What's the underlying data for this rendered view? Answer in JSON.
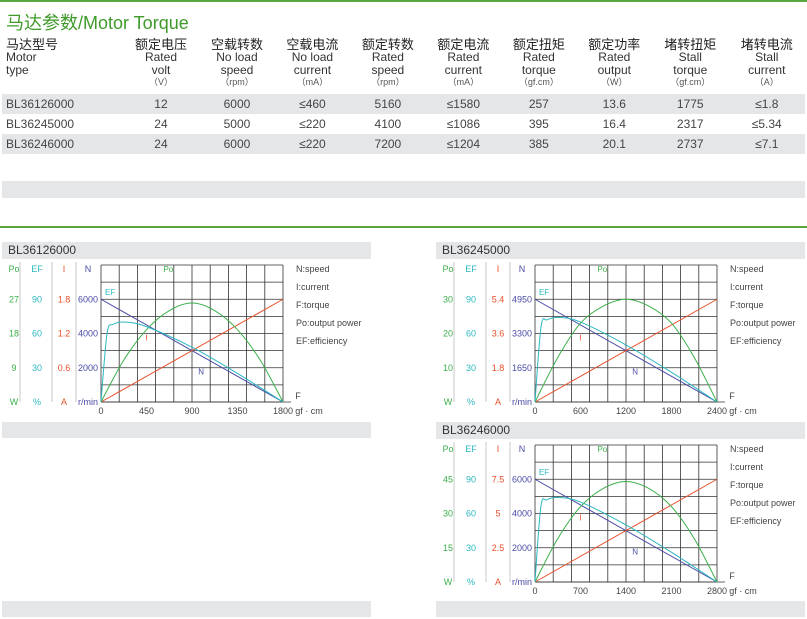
{
  "page_title": "马达参数/Motor Torque",
  "colors": {
    "accent": "#5aa53c",
    "po": "#3bb04a",
    "ef": "#2ab8c0",
    "i": "#e8502a",
    "n": "#4a4aa6",
    "shade": "#e4e6e8"
  },
  "spec_table": {
    "headers": [
      {
        "cn": "马达型号",
        "en1": "Motor",
        "en2": "type",
        "unit": ""
      },
      {
        "cn": "额定电压",
        "en1": "Rated",
        "en2": "volt",
        "unit": "（V）"
      },
      {
        "cn": "空载转数",
        "en1": "No load",
        "en2": "speed",
        "unit": "（rpm）"
      },
      {
        "cn": "空载电流",
        "en1": "No load",
        "en2": "current",
        "unit": "（mA）"
      },
      {
        "cn": "额定转数",
        "en1": "Rated",
        "en2": "speed",
        "unit": "（rpm）"
      },
      {
        "cn": "额定电流",
        "en1": "Rated",
        "en2": "current",
        "unit": "（mA）"
      },
      {
        "cn": "额定扭矩",
        "en1": "Rated",
        "en2": "torque",
        "unit": "（gf.cm）"
      },
      {
        "cn": "额定功率",
        "en1": "Rated",
        "en2": "output",
        "unit": "（W）"
      },
      {
        "cn": "堵转扭矩",
        "en1": "Stall",
        "en2": "torque",
        "unit": "（gf.cm）"
      },
      {
        "cn": "堵转电流",
        "en1": "Stall",
        "en2": "current",
        "unit": "（A）"
      }
    ],
    "rows": [
      [
        "BL36126000",
        "12",
        "6000",
        "≤460",
        "5160",
        "≤1580",
        "257",
        "13.6",
        "1775",
        "≤1.8"
      ],
      [
        "BL36245000",
        "24",
        "5000",
        "≤220",
        "4100",
        "≤1086",
        "395",
        "16.4",
        "2317",
        "≤5.34"
      ],
      [
        "BL36246000",
        "24",
        "6000",
        "≤220",
        "7200",
        "≤1204",
        "385",
        "20.1",
        "2737",
        "≤7.1"
      ]
    ]
  },
  "chart_data": [
    {
      "type": "line",
      "title": "BL36126000",
      "xlabel": "gf · cm",
      "x_ticks": [
        "0",
        "450",
        "900",
        "1350",
        "1800"
      ],
      "xlim": [
        0,
        1800
      ],
      "axis_heads": {
        "po": "Po",
        "ef": "EF",
        "i": "I",
        "n": "N"
      },
      "axis_units": {
        "po": "W",
        "ef": "%",
        "i": "A",
        "n": "r/min"
      },
      "po_ticks": [
        "27",
        "18",
        "9"
      ],
      "ef_ticks": [
        "90",
        "60",
        "30"
      ],
      "i_ticks": [
        "1.8",
        "1.2",
        "0.6"
      ],
      "n_ticks": [
        "6000",
        "4000",
        "2000"
      ],
      "ylim_n": [
        0,
        8000
      ],
      "ylim_i": [
        0,
        2.4
      ],
      "ylim_po": [
        0,
        36
      ],
      "ylim_ef": [
        0,
        120
      ],
      "series": [
        {
          "name": "N",
          "label": "N",
          "x": [
            0,
            1800
          ],
          "y": [
            6000,
            0
          ]
        },
        {
          "name": "I",
          "label": "I",
          "x": [
            0,
            1800
          ],
          "y": [
            0,
            1.8
          ]
        },
        {
          "name": "Po",
          "label": "Po",
          "x": [
            0,
            225,
            450,
            675,
            900,
            1125,
            1350,
            1575,
            1800
          ],
          "y": [
            0,
            11,
            19,
            24,
            26,
            24,
            19,
            11,
            0
          ]
        },
        {
          "name": "EF",
          "label": "EF",
          "x": [
            0,
            60,
            120,
            240,
            450,
            900,
            1350,
            1800
          ],
          "y": [
            0,
            60,
            68,
            70,
            66,
            48,
            25,
            0
          ]
        }
      ],
      "legend": [
        "N:speed",
        "I:current",
        "F:torque",
        "Po:output power",
        "EF:efficiency"
      ]
    },
    {
      "type": "line",
      "title": "BL36245000",
      "xlabel": "gf · cm",
      "x_ticks": [
        "0",
        "600",
        "1200",
        "1800",
        "2400"
      ],
      "xlim": [
        0,
        2400
      ],
      "axis_heads": {
        "po": "Po",
        "ef": "EF",
        "i": "I",
        "n": "N"
      },
      "axis_units": {
        "po": "W",
        "ef": "%",
        "i": "A",
        "n": "r/min"
      },
      "po_ticks": [
        "30",
        "20",
        "10"
      ],
      "ef_ticks": [
        "90",
        "60",
        "30"
      ],
      "i_ticks": [
        "5.4",
        "3.6",
        "1.8"
      ],
      "n_ticks": [
        "4950",
        "3300",
        "1650"
      ],
      "ylim_n": [
        0,
        6600
      ],
      "ylim_i": [
        0,
        7.2
      ],
      "ylim_po": [
        0,
        40
      ],
      "ylim_ef": [
        0,
        120
      ],
      "series": [
        {
          "name": "N",
          "label": "N",
          "x": [
            0,
            2400
          ],
          "y": [
            4950,
            0
          ]
        },
        {
          "name": "I",
          "label": "I",
          "x": [
            0,
            2400
          ],
          "y": [
            0,
            5.4
          ]
        },
        {
          "name": "Po",
          "label": "Po",
          "x": [
            0,
            300,
            600,
            900,
            1200,
            1500,
            1800,
            2100,
            2400
          ],
          "y": [
            0,
            13,
            23,
            28,
            30,
            28,
            23,
            13,
            0
          ]
        },
        {
          "name": "EF",
          "label": "EF",
          "x": [
            0,
            80,
            160,
            320,
            600,
            1200,
            1800,
            2400
          ],
          "y": [
            0,
            66,
            72,
            74,
            70,
            50,
            26,
            0
          ]
        }
      ],
      "legend": [
        "N:speed",
        "I:current",
        "F:torque",
        "Po:output power",
        "EF:efficiency"
      ]
    },
    {
      "type": "line",
      "title": "BL36246000",
      "xlabel": "gf · cm",
      "x_ticks": [
        "0",
        "700",
        "1400",
        "2100",
        "2800"
      ],
      "xlim": [
        0,
        2800
      ],
      "axis_heads": {
        "po": "Po",
        "ef": "EF",
        "i": "I",
        "n": "N"
      },
      "axis_units": {
        "po": "W",
        "ef": "%",
        "i": "A",
        "n": "r/min"
      },
      "po_ticks": [
        "45",
        "30",
        "15"
      ],
      "ef_ticks": [
        "90",
        "60",
        "30"
      ],
      "i_ticks": [
        "7.5",
        "5",
        "2.5"
      ],
      "n_ticks": [
        "6000",
        "4000",
        "2000"
      ],
      "ylim_n": [
        0,
        8000
      ],
      "ylim_i": [
        0,
        10
      ],
      "ylim_po": [
        0,
        60
      ],
      "ylim_ef": [
        0,
        120
      ],
      "series": [
        {
          "name": "N",
          "label": "N",
          "x": [
            0,
            2800
          ],
          "y": [
            6000,
            0
          ]
        },
        {
          "name": "I",
          "label": "I",
          "x": [
            0,
            2800
          ],
          "y": [
            0,
            7.5
          ]
        },
        {
          "name": "Po",
          "label": "Po",
          "x": [
            0,
            350,
            700,
            1050,
            1400,
            1750,
            2100,
            2450,
            2800
          ],
          "y": [
            0,
            19,
            33,
            41,
            44,
            41,
            33,
            19,
            0
          ]
        },
        {
          "name": "EF",
          "label": "EF",
          "x": [
            0,
            90,
            180,
            360,
            700,
            1400,
            2100,
            2800
          ],
          "y": [
            0,
            66,
            72,
            74,
            70,
            50,
            26,
            0
          ]
        }
      ],
      "legend": [
        "N:speed",
        "I:current",
        "F:torque",
        "Po:output power",
        "EF:efficiency"
      ]
    }
  ]
}
